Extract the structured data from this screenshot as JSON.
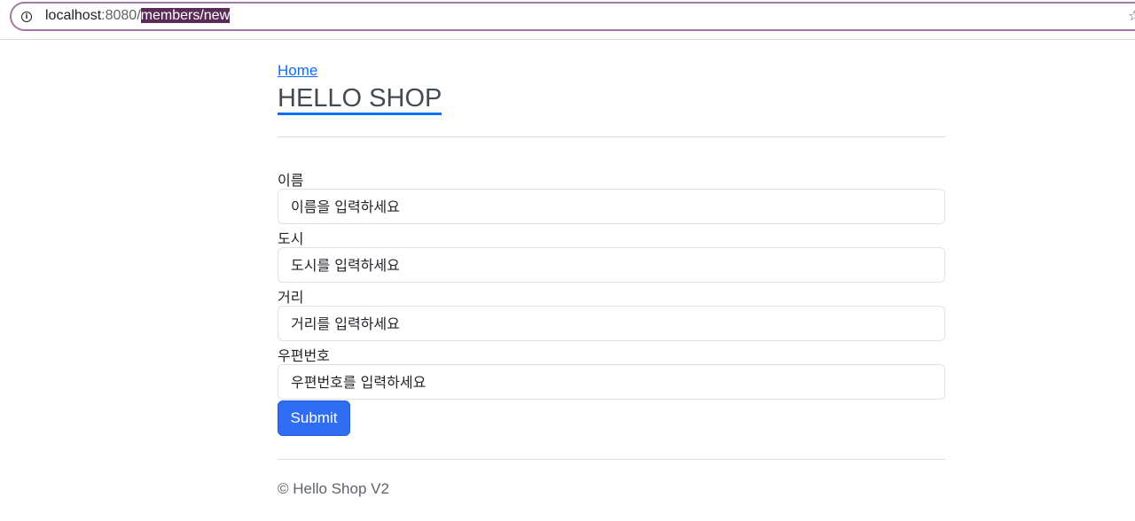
{
  "browser": {
    "url_host": "localhost",
    "url_port": ":8080/",
    "url_path": "members/new",
    "info_icon_glyph": "i",
    "star_icon_glyph": "☆"
  },
  "header": {
    "home_link": "Home",
    "title": "HELLO SHOP"
  },
  "form": {
    "fields": [
      {
        "label": "이름",
        "placeholder": "이름을 입력하세요"
      },
      {
        "label": "도시",
        "placeholder": "도시를 입력하세요"
      },
      {
        "label": "거리",
        "placeholder": "거리를 입력하세요"
      },
      {
        "label": "우편번호",
        "placeholder": "우편번호를 입력하세요"
      }
    ],
    "submit_label": "Submit"
  },
  "footer": {
    "text": "© Hello Shop V2"
  },
  "colors": {
    "accent": "#0d6efd",
    "button": "#2f6ef2",
    "url_selection": "#5b2b57"
  }
}
